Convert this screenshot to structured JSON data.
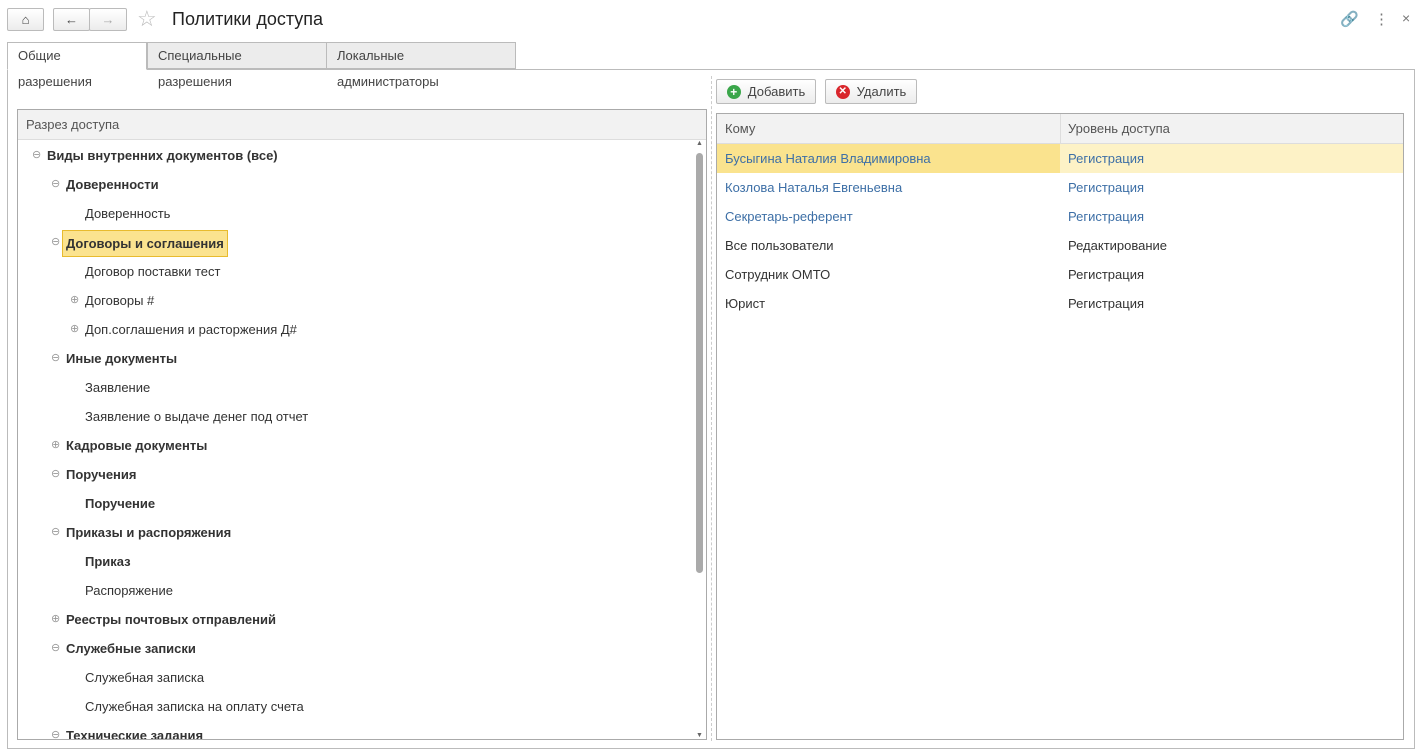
{
  "header": {
    "title": "Политики доступа"
  },
  "tabs": [
    {
      "label": "Общие разрешения"
    },
    {
      "label": "Специальные разрешения"
    },
    {
      "label": "Локальные администраторы"
    }
  ],
  "tree": {
    "column": "Разрез доступа",
    "items": [
      {
        "label": "Виды внутренних документов (все)",
        "level": 0,
        "state": "expanded",
        "bold": true
      },
      {
        "label": "Доверенности",
        "level": 1,
        "state": "expanded",
        "bold": true
      },
      {
        "label": "Доверенность",
        "level": 2,
        "state": "leaf",
        "bold": false
      },
      {
        "label": "Договоры и соглашения",
        "level": 1,
        "state": "expanded",
        "bold": true,
        "selected": true
      },
      {
        "label": "Договор поставки тест",
        "level": 2,
        "state": "leaf",
        "bold": false
      },
      {
        "label": "Договоры #",
        "level": 2,
        "state": "collapsed",
        "bold": false
      },
      {
        "label": "Доп.соглашения и расторжения Д#",
        "level": 2,
        "state": "collapsed",
        "bold": false
      },
      {
        "label": "Иные документы",
        "level": 1,
        "state": "expanded",
        "bold": true
      },
      {
        "label": "Заявление",
        "level": 2,
        "state": "leaf",
        "bold": false
      },
      {
        "label": "Заявление о выдаче денег под отчет",
        "level": 2,
        "state": "leaf",
        "bold": false
      },
      {
        "label": "Кадровые документы",
        "level": 1,
        "state": "collapsed",
        "bold": true
      },
      {
        "label": "Поручения",
        "level": 1,
        "state": "expanded",
        "bold": true
      },
      {
        "label": "Поручение",
        "level": 2,
        "state": "leaf",
        "bold": true
      },
      {
        "label": "Приказы и распоряжения",
        "level": 1,
        "state": "expanded",
        "bold": true
      },
      {
        "label": "Приказ",
        "level": 2,
        "state": "leaf",
        "bold": true
      },
      {
        "label": "Распоряжение",
        "level": 2,
        "state": "leaf",
        "bold": false
      },
      {
        "label": "Реестры почтовых отправлений",
        "level": 1,
        "state": "collapsed",
        "bold": true
      },
      {
        "label": "Служебные записки",
        "level": 1,
        "state": "expanded",
        "bold": true
      },
      {
        "label": "Служебная записка",
        "level": 2,
        "state": "leaf",
        "bold": false
      },
      {
        "label": "Служебная записка на оплату счета",
        "level": 2,
        "state": "leaf",
        "bold": false
      },
      {
        "label": "Технические задания",
        "level": 1,
        "state": "expanded",
        "bold": true
      }
    ]
  },
  "toolbar": {
    "add": "Добавить",
    "delete": "Удалить"
  },
  "table": {
    "columns": [
      "Кому",
      "Уровень доступа"
    ],
    "rows": [
      {
        "who": "Бусыгина Наталия Владимировна",
        "level": "Регистрация",
        "link": true,
        "selected": true
      },
      {
        "who": "Козлова Наталья Евгеньевна",
        "level": "Регистрация",
        "link": true
      },
      {
        "who": "Секретарь-референт",
        "level": "Регистрация",
        "link": true
      },
      {
        "who": "Все пользователи",
        "level": "Редактирование",
        "link": false
      },
      {
        "who": "Сотрудник ОМТО",
        "level": "Регистрация",
        "link": false
      },
      {
        "who": "Юрист",
        "level": "Регистрация",
        "link": false
      }
    ]
  }
}
